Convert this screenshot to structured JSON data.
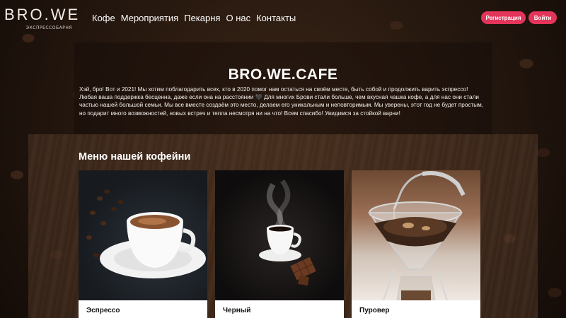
{
  "header": {
    "logo": "BRO.WE",
    "logo_sub": "ЭКСПРЕССОБАРНЯ",
    "nav": [
      "Кофе",
      "Мероприятия",
      "Пекарня",
      "О нас",
      "Контакты"
    ],
    "register_label": "Регистрация",
    "login_label": "Войти"
  },
  "hero": {
    "title": "BRO.WE.CAFE",
    "text": "Хэй, бро! Вот и 2021! Мы хотим поблагодарить всех, кто в 2020 помог нам остаться на своём месте, быть собой и продолжить варить эспрессо! Любая ваша поддержка бесценна, даже если она на расстоянии 🖤 Для многих Брови стали больше, чем вкусная чашка кофе, а для нас они стали частью нашей большой семьи. Мы все вместе создаём это место, делаем его уникальным и неповторимым. Мы уверены, этот год не будет простым, но подарит много возможностей, новых встреч и тепла несмотря ни на что! Всем спасибо! Увидимся за стойкой варни!"
  },
  "menu": {
    "title": "Меню нашей кофейни",
    "cards": [
      {
        "label": "Эспрессо",
        "icon": "espresso-cup-image"
      },
      {
        "label": "Черный",
        "icon": "black-coffee-cup-image"
      },
      {
        "label": "Пуровер",
        "icon": "pour-over-image"
      }
    ]
  },
  "colors": {
    "accent": "#e3345a",
    "background": "#20140d"
  }
}
